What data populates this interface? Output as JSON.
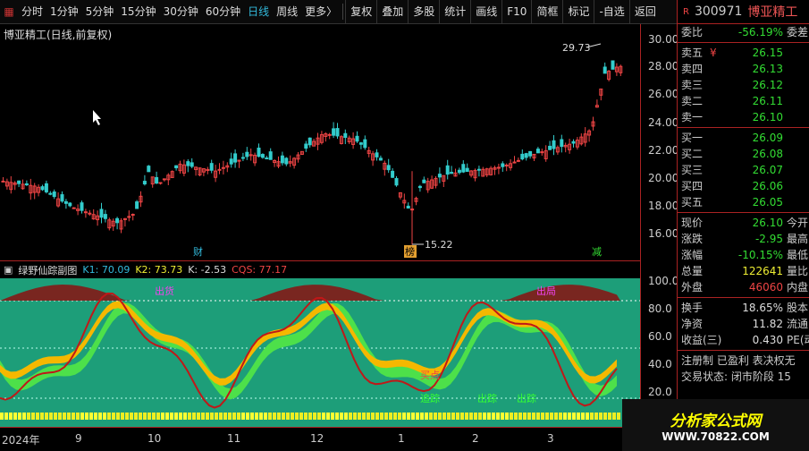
{
  "toolbar": {
    "items": [
      "分时",
      "1分钟",
      "5分钟",
      "15分钟",
      "30分钟",
      "60分钟",
      "日线",
      "周线",
      "更多〉"
    ],
    "active": "日线",
    "tools": [
      "复权",
      "叠加",
      "多股",
      "统计",
      "画线",
      "F10",
      "简框",
      "标记",
      "-自选",
      "返回"
    ]
  },
  "stock": {
    "code": "300971",
    "name": "博亚精工",
    "chart_title": "博亚精工(日线,前复权)",
    "high_label": "29.73",
    "low_label": "15.22"
  },
  "price_axis": [
    "30.00",
    "28.00",
    "26.00",
    "24.00",
    "22.00",
    "20.00",
    "18.00",
    "16.00"
  ],
  "markers": {
    "m1": "财",
    "m2": "榜",
    "m3": "减"
  },
  "indicator": {
    "name": "绿野仙踪副图",
    "k1": "K1: 70.09",
    "k2": "K2: 73.73",
    "k": "K: -2.53",
    "cqs": "CQS: 77.17",
    "labels": {
      "out": "出货",
      "chu": "出局",
      "buy": "买点",
      "zhui": "追踪",
      "chuzong1": "出踪",
      "chuzong2": "出踪"
    }
  },
  "sub_axis": [
    "100.0",
    "80.0",
    "60.0",
    "40.0",
    "20.0"
  ],
  "time_axis": [
    "2024年",
    "9",
    "10",
    "11",
    "12",
    "1",
    "2",
    "3"
  ],
  "quote": {
    "weibi": {
      "k": "委比",
      "v": "-56.19%",
      "x": "委差"
    },
    "asks": [
      {
        "k": "卖五",
        "v": "26.15"
      },
      {
        "k": "卖四",
        "v": "26.13"
      },
      {
        "k": "卖三",
        "v": "26.12"
      },
      {
        "k": "卖二",
        "v": "26.11"
      },
      {
        "k": "卖一",
        "v": "26.10"
      }
    ],
    "ask5_sym": "¥",
    "bids": [
      {
        "k": "买一",
        "v": "26.09"
      },
      {
        "k": "买二",
        "v": "26.08"
      },
      {
        "k": "买三",
        "v": "26.07"
      },
      {
        "k": "买四",
        "v": "26.06"
      },
      {
        "k": "买五",
        "v": "26.05"
      }
    ],
    "stats": [
      {
        "k": "现价",
        "v": "26.10",
        "x": "今开"
      },
      {
        "k": "涨跌",
        "v": "-2.95",
        "x": "最高"
      },
      {
        "k": "涨幅",
        "v": "-10.15%",
        "x": "最低"
      },
      {
        "k": "总量",
        "v": "122641",
        "x": "量比"
      },
      {
        "k": "外盘",
        "v": "46060",
        "x": "内盘"
      }
    ],
    "stats2": [
      {
        "k": "换手",
        "v": "18.65%",
        "x": "股本"
      },
      {
        "k": "净资",
        "v": "11.82",
        "x": "流通"
      },
      {
        "k": "收益(三)",
        "v": "0.430",
        "x": "PE(动)"
      }
    ],
    "footer1": "注册制 已盈利 表决权无",
    "footer2": "交易状态: 闭市阶段 15"
  },
  "logo": {
    "l1": "分析家公式网",
    "l2": "WWW.70822.COM"
  },
  "colors": {
    "up": "#e44",
    "down": "#3cc",
    "accent": "#3bd"
  }
}
